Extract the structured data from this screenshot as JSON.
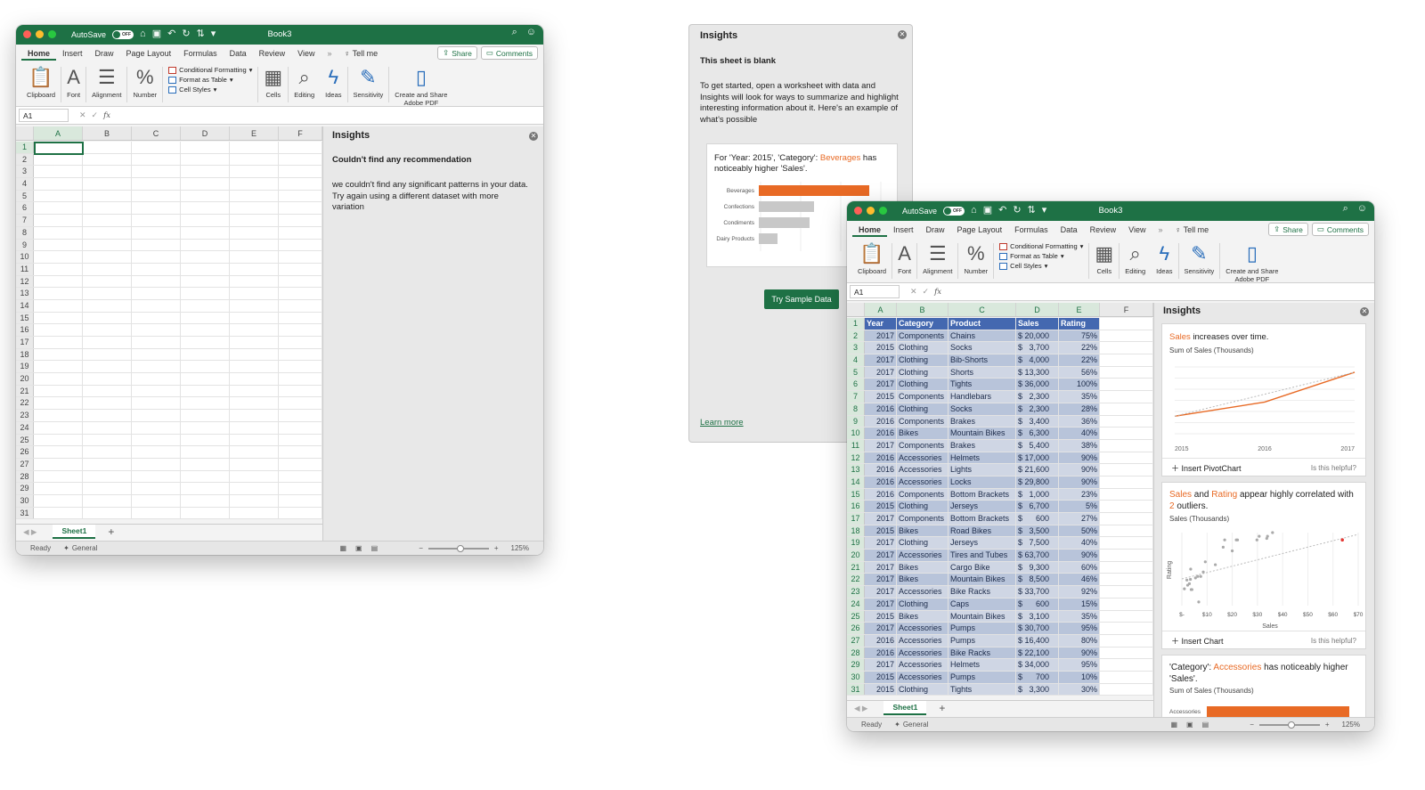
{
  "win1": {
    "autosave": "AutoSave",
    "autosave_state": "OFF",
    "title": "Book3",
    "tabs": [
      "Home",
      "Insert",
      "Draw",
      "Page Layout",
      "Formulas",
      "Data",
      "Review",
      "View"
    ],
    "tellme": "Tell me",
    "share": "Share",
    "comments": "Comments",
    "ribbon": {
      "clipboard": "Clipboard",
      "font": "Font",
      "alignment": "Alignment",
      "number": "Number",
      "cond_format": "Conditional Formatting",
      "format_table": "Format as Table",
      "cell_styles": "Cell Styles",
      "cells": "Cells",
      "editing": "Editing",
      "ideas": "Ideas",
      "sensitivity": "Sensitivity",
      "pdf1": "Create and Share",
      "pdf2": "Adobe PDF"
    },
    "namebox": "A1",
    "columns": [
      "A",
      "B",
      "C",
      "D",
      "E",
      "F"
    ],
    "rows": [
      "1",
      "2",
      "3",
      "4",
      "5",
      "6",
      "7",
      "8",
      "9",
      "10",
      "11",
      "12",
      "13",
      "14",
      "15",
      "16",
      "17",
      "18",
      "19",
      "20",
      "21",
      "22",
      "23",
      "24",
      "25",
      "26",
      "27",
      "28",
      "29",
      "30",
      "31"
    ],
    "pane": {
      "title": "Insights",
      "heading": "Couldn't find any recommendation",
      "body": "we couldn't find any significant patterns in your data. Try again using a different dataset with more variation"
    },
    "sheet": "Sheet1",
    "status": "Ready",
    "general": "General",
    "zoom": "125%"
  },
  "blank": {
    "title": "Insights",
    "heading": "This sheet is blank",
    "body": "To get started, open a worksheet with data and Insights will look for ways to summarize and highlight interesting information about it. Here's an example of what's possible",
    "card_text_a": "For 'Year: 2015', 'Category': ",
    "card_highlight": "Beverages",
    "card_text_b": " has noticeably higher 'Sales'.",
    "bars": [
      {
        "label": "Beverages",
        "value": 1.0
      },
      {
        "label": "Confections",
        "value": 0.5
      },
      {
        "label": "Condiments",
        "value": 0.46
      },
      {
        "label": "Dairy Products",
        "value": 0.17
      }
    ],
    "button": "Try Sample Data",
    "learn_more": "Learn more"
  },
  "win2": {
    "columns": [
      "A",
      "B",
      "C",
      "D",
      "E",
      "F"
    ],
    "headers": [
      "Year",
      "Category",
      "Product",
      "Sales",
      "Rating"
    ],
    "table": [
      [
        "2017",
        "Components",
        "Chains",
        "$ 20,000",
        "75%"
      ],
      [
        "2015",
        "Clothing",
        "Socks",
        "$   3,700",
        "22%"
      ],
      [
        "2017",
        "Clothing",
        "Bib-Shorts",
        "$   4,000",
        "22%"
      ],
      [
        "2017",
        "Clothing",
        "Shorts",
        "$ 13,300",
        "56%"
      ],
      [
        "2017",
        "Clothing",
        "Tights",
        "$ 36,000",
        "100%"
      ],
      [
        "2015",
        "Components",
        "Handlebars",
        "$   2,300",
        "35%"
      ],
      [
        "2016",
        "Clothing",
        "Socks",
        "$   2,300",
        "28%"
      ],
      [
        "2016",
        "Components",
        "Brakes",
        "$   3,400",
        "36%"
      ],
      [
        "2016",
        "Bikes",
        "Mountain Bikes",
        "$   6,300",
        "40%"
      ],
      [
        "2017",
        "Components",
        "Brakes",
        "$   5,400",
        "38%"
      ],
      [
        "2016",
        "Accessories",
        "Helmets",
        "$ 17,000",
        "90%"
      ],
      [
        "2016",
        "Accessories",
        "Lights",
        "$ 21,600",
        "90%"
      ],
      [
        "2016",
        "Accessories",
        "Locks",
        "$ 29,800",
        "90%"
      ],
      [
        "2016",
        "Components",
        "Bottom Brackets",
        "$   1,000",
        "23%"
      ],
      [
        "2015",
        "Clothing",
        "Jerseys",
        "$   6,700",
        "5%"
      ],
      [
        "2017",
        "Components",
        "Bottom Brackets",
        "$      600",
        "27%"
      ],
      [
        "2015",
        "Bikes",
        "Road Bikes",
        "$   3,500",
        "50%"
      ],
      [
        "2017",
        "Clothing",
        "Jerseys",
        "$   7,500",
        "40%"
      ],
      [
        "2017",
        "Accessories",
        "Tires and Tubes",
        "$ 63,700",
        "90%"
      ],
      [
        "2017",
        "Bikes",
        "Cargo Bike",
        "$   9,300",
        "60%"
      ],
      [
        "2017",
        "Bikes",
        "Mountain Bikes",
        "$   8,500",
        "46%"
      ],
      [
        "2017",
        "Accessories",
        "Bike Racks",
        "$ 33,700",
        "92%"
      ],
      [
        "2017",
        "Clothing",
        "Caps",
        "$      600",
        "15%"
      ],
      [
        "2015",
        "Bikes",
        "Mountain Bikes",
        "$   3,100",
        "35%"
      ],
      [
        "2017",
        "Accessories",
        "Pumps",
        "$ 30,700",
        "95%"
      ],
      [
        "2016",
        "Accessories",
        "Pumps",
        "$ 16,400",
        "80%"
      ],
      [
        "2016",
        "Accessories",
        "Bike Racks",
        "$ 22,100",
        "90%"
      ],
      [
        "2017",
        "Accessories",
        "Helmets",
        "$ 34,000",
        "95%"
      ],
      [
        "2015",
        "Accessories",
        "Pumps",
        "$      700",
        "10%"
      ],
      [
        "2015",
        "Clothing",
        "Tights",
        "$   3,300",
        "30%"
      ]
    ],
    "card1": {
      "hl": "Sales",
      "text": " increases over time.",
      "sub": "Sum of Sales (Thousands)",
      "xticks": [
        "2015",
        "2016",
        "2017"
      ],
      "action": "Insert PivotChart",
      "helpful": "Is this helpful?"
    },
    "card2": {
      "hl1": "Sales",
      "and": " and ",
      "hl2": "Rating",
      "text_a": " appear highly correlated with ",
      "hl3": "2",
      "text_b": " outliers.",
      "sub": "Sales (Thousands)",
      "ylabel": "Rating",
      "xlabel": "Sales",
      "xticks": [
        "$-",
        "$10",
        "$20",
        "$30",
        "$40",
        "$50",
        "$60",
        "$70"
      ],
      "action": "Insert Chart",
      "helpful": "Is this helpful?"
    },
    "card3": {
      "text_a": "'Category': ",
      "hl": "Accessories",
      "text_b": " has noticeably higher 'Sales'.",
      "sub": "Sum of Sales (Thousands)",
      "bar_label": "Accessories"
    }
  },
  "chart_data": [
    {
      "type": "bar",
      "categories": [
        "Beverages",
        "Confections",
        "Condiments",
        "Dairy Products"
      ],
      "values": [
        1.0,
        0.5,
        0.46,
        0.17
      ]
    },
    {
      "type": "line",
      "x": [
        "2015",
        "2016",
        "2017"
      ],
      "series": [
        {
          "values": [
            10,
            18,
            35
          ]
        }
      ]
    },
    {
      "type": "scatter",
      "xlabel": "Sales",
      "ylabel": "Rating",
      "x": [
        1,
        2,
        2.3,
        3,
        3.4,
        3.5,
        3.7,
        4,
        5.4,
        6.3,
        6.7,
        7.5,
        8.5,
        9.3,
        13.3,
        16.4,
        17,
        20,
        21.6,
        22.1,
        29.8,
        30.7,
        33.7,
        34,
        36,
        63.7
      ],
      "y": [
        23,
        35,
        28,
        30,
        36,
        50,
        22,
        22,
        38,
        40,
        5,
        40,
        46,
        60,
        56,
        80,
        90,
        75,
        90,
        90,
        90,
        95,
        92,
        95,
        100,
        90
      ]
    }
  ]
}
